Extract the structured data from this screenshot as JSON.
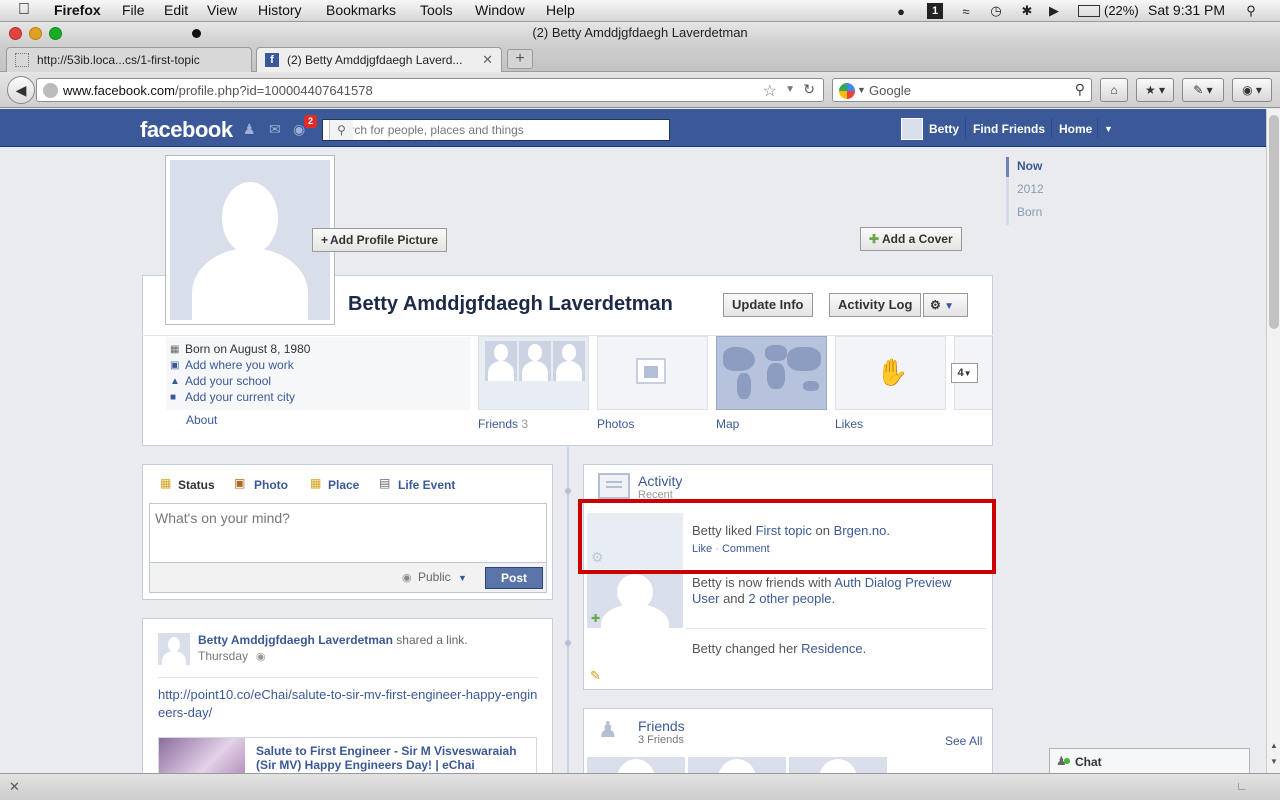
{
  "menubar": {
    "app": "Firefox",
    "items": [
      "File",
      "Edit",
      "View",
      "History",
      "Bookmarks",
      "Tools",
      "Window",
      "Help"
    ],
    "battery": "(22%)",
    "clock": "Sat 9:31 PM"
  },
  "window": {
    "title": "(2) Betty Amddjgfdaegh Laverdetman"
  },
  "tabs": [
    {
      "label": "http://53ib.loca...cs/1-first-topic"
    },
    {
      "label": "(2) Betty Amddjgfdaegh Laverd..."
    }
  ],
  "address": {
    "domain": "www.facebook.com",
    "path": "/profile.php?id=100004407641578"
  },
  "search": {
    "placeholder": "Google"
  },
  "fb": {
    "logo": "facebook",
    "notification_count": "2",
    "search_placeholder": "Search for people, places and things",
    "user": "Betty",
    "find_friends": "Find Friends",
    "home": "Home"
  },
  "profile": {
    "name": "Betty Amddjgfdaegh Laverdetman",
    "add_profile_picture": "Add Profile Picture",
    "add_cover": "Add a Cover",
    "update_info": "Update Info",
    "activity_log": "Activity Log",
    "info": [
      "Born on August 8, 1980",
      "Add where you work",
      "Add your school",
      "Add your current city"
    ],
    "about": "About",
    "tiles": [
      {
        "label": "Friends",
        "count": "3"
      },
      {
        "label": "Photos"
      },
      {
        "label": "Map"
      },
      {
        "label": "Likes"
      }
    ],
    "more_count": "4"
  },
  "timeline_nav": [
    "Now",
    "2012",
    "Born"
  ],
  "composer": {
    "tabs": [
      "Status",
      "Photo",
      "Place",
      "Life Event"
    ],
    "placeholder": "What's on your mind?",
    "audience": "Public",
    "post": "Post"
  },
  "story": {
    "author": "Betty Amddjgfdaegh Laverdetman",
    "action": "shared a link.",
    "time": "Thursday",
    "link": "http://point10.co/eChai/salute-to-sir-mv-first-engineer-happy-engineers-day/",
    "preview_title": "Salute to First Engineer - Sir M Visveswaraiah (Sir MV) Happy Engineers Day! | eChai"
  },
  "activity": {
    "title": "Activity",
    "subtitle": "Recent",
    "item1": {
      "text1": "Betty liked ",
      "link1": "First topic",
      "text2": " on ",
      "link2": "Brgen.no",
      "text3": ".",
      "like": "Like",
      "comment": "Comment"
    },
    "item2": {
      "text1": "Betty is now friends with ",
      "link1": "Auth Dialog Preview User",
      "text2": " and ",
      "link2": "2 other people",
      "text3": "."
    },
    "item3": {
      "text1": "Betty changed her ",
      "link1": "Residence",
      "text2": "."
    }
  },
  "friends_box": {
    "title": "Friends",
    "count": "3 Friends",
    "see_all": "See All"
  },
  "chat": {
    "label": "Chat"
  },
  "colors": {
    "fb_blue": "#3b5998",
    "highlight": "#cc0000"
  }
}
